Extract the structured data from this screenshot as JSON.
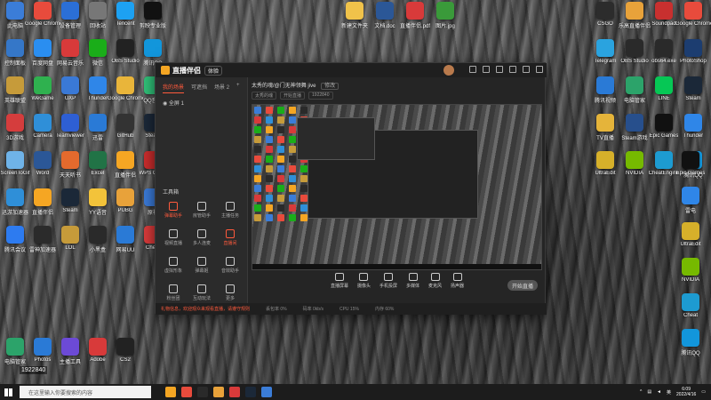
{
  "desktop": {
    "left_icons": [
      {
        "label": "此电脑",
        "color": "#3b7dd8"
      },
      {
        "label": "Google Chrome",
        "color": "#e84b3c"
      },
      {
        "label": "设备管理",
        "color": "#2b6fd6"
      },
      {
        "label": "回收站",
        "color": "#777777"
      },
      {
        "label": "Tencent",
        "color": "#1da1f2"
      },
      {
        "label": "剪映专业版",
        "color": "#111111"
      },
      {
        "label": "控制面板",
        "color": "#3577c8"
      },
      {
        "label": "百度网盘",
        "color": "#2a8ef0"
      },
      {
        "label": "网易云音乐",
        "color": "#d83a3a"
      },
      {
        "label": "微信",
        "color": "#1aad19"
      },
      {
        "label": "OBS Studio",
        "color": "#222222"
      },
      {
        "label": "腾讯QQ",
        "color": "#1296db"
      },
      {
        "label": "英雄联盟",
        "color": "#c69b3a"
      },
      {
        "label": "WeGame",
        "color": "#2fb14f"
      },
      {
        "label": "UXP",
        "color": "#3a79d6"
      },
      {
        "label": "Thunder",
        "color": "#2f86e8"
      },
      {
        "label": "Google Chrome",
        "color": "#e9b53a"
      },
      {
        "label": "QQ音乐",
        "color": "#30c078"
      },
      {
        "label": "3D游戏",
        "color": "#d53d3d"
      },
      {
        "label": "Camera",
        "color": "#2f8fd8"
      },
      {
        "label": "Teamviewer",
        "color": "#2e5fd4"
      },
      {
        "label": "迅雷",
        "color": "#2a7ad6"
      },
      {
        "label": "GitHub",
        "color": "#333333"
      },
      {
        "label": "Steam",
        "color": "#1b2838"
      },
      {
        "label": "ScreenToGif",
        "color": "#6fb3e8"
      },
      {
        "label": "Word",
        "color": "#2b5797"
      },
      {
        "label": "天天听书",
        "color": "#e46a2d"
      },
      {
        "label": "Excel",
        "color": "#217346"
      },
      {
        "label": "直播伴侣",
        "color": "#f5a623"
      },
      {
        "label": "WPS Office",
        "color": "#c92c2c"
      }
    ],
    "right_icons": [
      {
        "label": "CSGO",
        "color": "#2c2c2c"
      },
      {
        "label": "乐高直播伴侣",
        "color": "#e8a23a"
      },
      {
        "label": "Soundpad",
        "color": "#c8302f"
      },
      {
        "label": "Google Chrome",
        "color": "#e84b3c"
      },
      {
        "label": "Telegram",
        "color": "#2aa3df"
      },
      {
        "label": "OBS Studio",
        "color": "#2a2a2a"
      },
      {
        "label": "obs64.exe",
        "color": "#2a2a2a"
      },
      {
        "label": "PhotoShop",
        "color": "#1c3d70"
      },
      {
        "label": "腾讯视频",
        "color": "#2a7ad6"
      },
      {
        "label": "电脑管家",
        "color": "#2ca36a"
      },
      {
        "label": "LINE",
        "color": "#06c755"
      },
      {
        "label": "Steam",
        "color": "#1b2838"
      },
      {
        "label": "TV直播",
        "color": "#e5b43a"
      },
      {
        "label": "Steam游戏",
        "color": "#274f8c"
      },
      {
        "label": "Epic Games",
        "color": "#111111"
      },
      {
        "label": "Thunder",
        "color": "#2f86e8"
      },
      {
        "label": "UltraEdit",
        "color": "#d6b02a"
      },
      {
        "label": "NVIDIA",
        "color": "#76b900"
      },
      {
        "label": "CheatEngine",
        "color": "#1d9bd1"
      },
      {
        "label": "腾讯QQ",
        "color": "#1296db"
      }
    ],
    "desktop_files": [
      {
        "label": "新建文件夹",
        "color": "#f0c24a"
      },
      {
        "label": "文档.doc",
        "color": "#2b5797"
      },
      {
        "label": "直播伴侣.pdf",
        "color": "#d83a3a"
      },
      {
        "label": "图片.jpg",
        "color": "#3a9a3a"
      }
    ],
    "badge_number": "1922840"
  },
  "app": {
    "name": "直播伴侣",
    "version": "体验",
    "sidebar_tabs": [
      "我的场景",
      "可遮挡",
      "场景 2"
    ],
    "scene_label": "全屏 1",
    "tools_title": "工具箱",
    "tools": [
      {
        "label": "弹幕助手",
        "active": true
      },
      {
        "label": "房管助手",
        "active": false
      },
      {
        "label": "主播任务",
        "active": false
      },
      {
        "label": "视频直播",
        "active": false
      },
      {
        "label": "多人连麦",
        "active": false
      },
      {
        "label": "直播间",
        "active": true
      },
      {
        "label": "虚拟形象",
        "active": false
      },
      {
        "label": "弹幕姬",
        "active": false
      },
      {
        "label": "音效助手",
        "active": false
      },
      {
        "label": "粉丝团",
        "active": false
      },
      {
        "label": "互动玩法",
        "active": false
      },
      {
        "label": "更多",
        "active": false
      }
    ],
    "room_title": "太秀的魂/@门无神领舞 jive",
    "room_edit": "修改",
    "tags": [
      "太秀的魂",
      "开始直播",
      "1922840"
    ],
    "bottom_buttons": [
      "直播屏幕",
      "摄像头",
      "手机投屏",
      "多媒体",
      "麦克风",
      "扬声器"
    ],
    "start_live": "开始直播",
    "status_items": [
      {
        "text": "礼物信息，欢迎观众来观看直播，请遵守规则",
        "red": true
      },
      {
        "text": "丢包率 0%"
      },
      {
        "text": "码率 0kb/s"
      },
      {
        "text": "CPU 15%"
      },
      {
        "text": "内存 60%"
      }
    ]
  },
  "taskbar": {
    "search_placeholder": "在这里输入你要搜索的内容",
    "apps": [
      "#f5a623",
      "#e84b3c",
      "#2a2a2a",
      "#e8a23a",
      "#d83a3a",
      "#1b2838",
      "#3b7dd8"
    ],
    "time": "6:09",
    "date": "2022/4/16"
  }
}
